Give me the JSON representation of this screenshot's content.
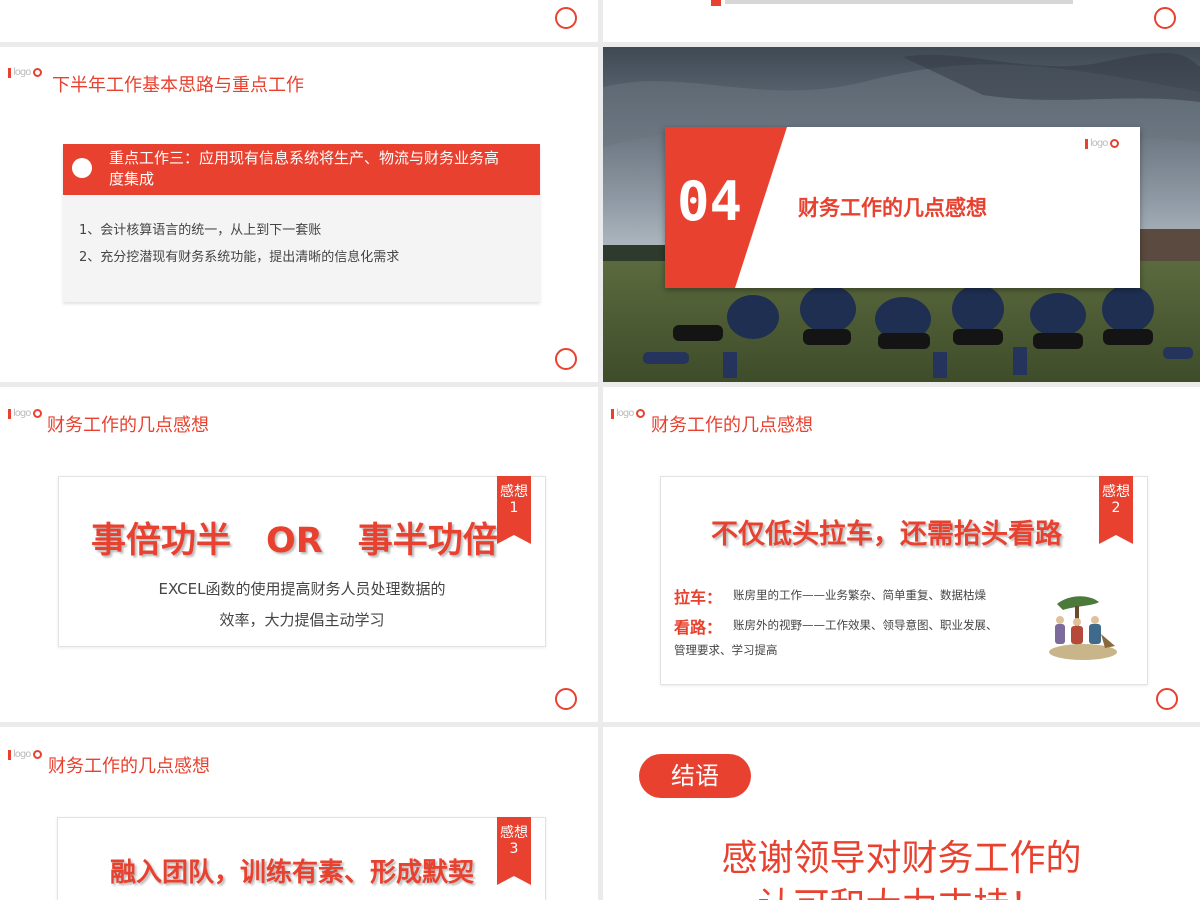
{
  "logo": {
    "text": "logo"
  },
  "top_left": {},
  "top_right": {},
  "s1": {
    "title": "下半年工作基本思路与重点工作",
    "box_title": "重点工作三：应用现有信息系统将生产、物流与财务业务高度集成",
    "items": [
      "1、会计核算语言的统一，从上到下一套账",
      "2、充分挖潜现有财务系统功能，提出清晰的信息化需求"
    ]
  },
  "s2": {
    "number": "04",
    "title": "财务工作的几点感想"
  },
  "s3": {
    "title": "财务工作的几点感想",
    "tag": "感想1",
    "headline": "事倍功半　OR　事半功倍",
    "body1": "EXCEL函数的使用提高财务人员处理数据的",
    "body2": "效率，大力提倡主动学习"
  },
  "s4": {
    "title": "财务工作的几点感想",
    "tag": "感想2",
    "headline": "不仅低头拉车，还需抬头看路",
    "label1": "拉车：",
    "text1": "账房里的工作——业务繁杂、简单重复、数据枯燥",
    "label2": "看路：",
    "text2": "账房外的视野——工作效果、领导意图、职业发展、",
    "text3": "管理要求、学习提高"
  },
  "s5": {
    "title": "财务工作的几点感想",
    "tag": "感想3",
    "headline": "融入团队，训练有素、形成默契"
  },
  "s6": {
    "pill": "结语",
    "line1": "感谢领导对财务工作的",
    "line2": "认可和大力支持！"
  },
  "colors": {
    "accent": "#e8412f",
    "text": "#444444",
    "bg": "#ebebeb"
  }
}
